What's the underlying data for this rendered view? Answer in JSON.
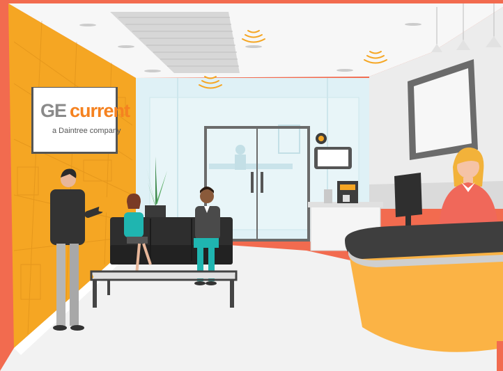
{
  "sign": {
    "brand_part1": "GE",
    "brand_part2": "current",
    "tagline": "a Daintree company"
  },
  "colors": {
    "frame": "#f26b4f",
    "accent_orange": "#f58220",
    "wall_yellow": "#f5a623",
    "desk_yellow": "#fbb345",
    "glass_blue": "#dff1f6",
    "sensor_signal": "#f5a623"
  },
  "icons": {
    "sensor": "wifi-signal-icon",
    "monitor": "computer-monitor-icon",
    "tablet": "tablet-icon",
    "coffee_machine": "coffee-machine-icon",
    "thermostat": "thermostat-icon",
    "pendant_lamp": "pendant-lamp-icon"
  }
}
